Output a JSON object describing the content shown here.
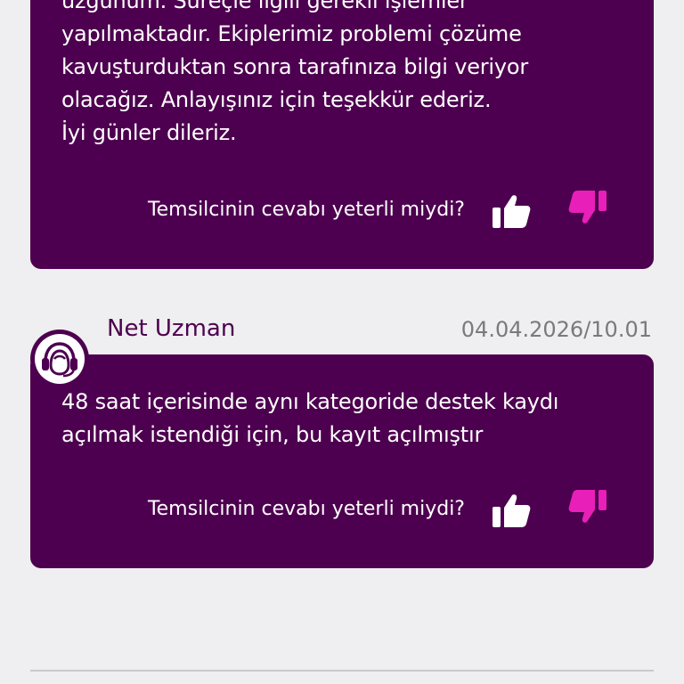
{
  "colors": {
    "bubble": "#4d004f",
    "background": "#efeef0",
    "like": "#ffffff",
    "dislike": "#e81fb8",
    "timestamp": "#7a7a7a"
  },
  "messages": [
    {
      "lines": [
        "üzgünüm. Süreçle ilgili gerekli işlemler",
        "yapılmaktadır. Ekiplerimiz problemi çözüme",
        "kavuşturduktan sonra tarafınıza bilgi veriyor",
        "olacağız. Anlayışınız için teşekkür ederiz.",
        "İyi günler dileriz."
      ],
      "feedback_question": "Temsilcinin cevabı yeterli miydi?",
      "like_icon": "thumbs-up-icon",
      "dislike_icon": "thumbs-down-icon"
    },
    {
      "sender": "Net Uzman",
      "timestamp": "04.04.2026/10.01",
      "avatar_icon": "support-agent-icon",
      "lines": [
        "48 saat içerisinde aynı kategoride destek kaydı",
        "açılmak istendiği için, bu kayıt açılmıştır"
      ],
      "feedback_question": "Temsilcinin cevabı yeterli miydi?",
      "like_icon": "thumbs-up-icon",
      "dislike_icon": "thumbs-down-icon"
    }
  ]
}
